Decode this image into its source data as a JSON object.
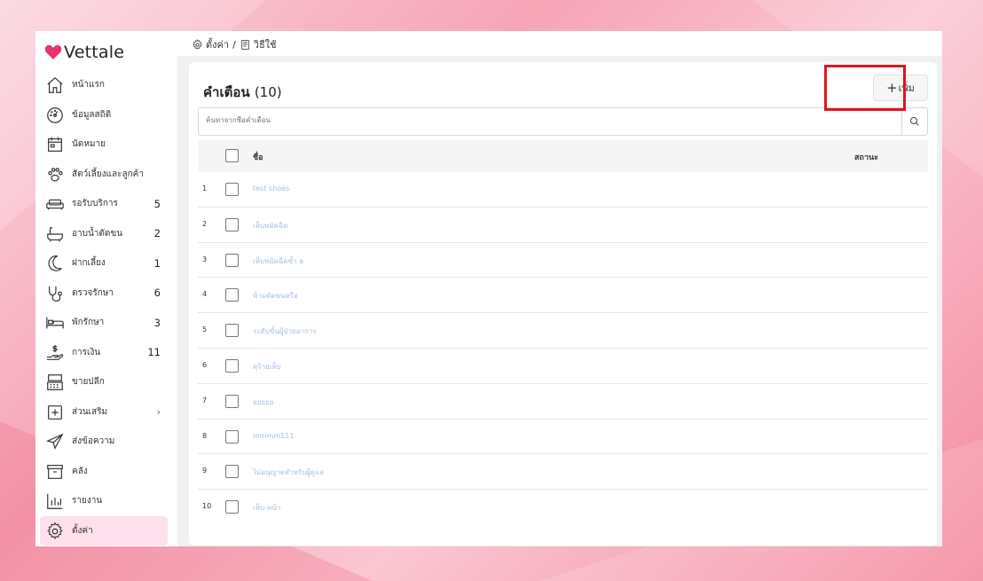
{
  "brand": {
    "name": "Vettale",
    "color": "#e8336d"
  },
  "sidebar": {
    "items": [
      {
        "label": "หน้าแรก",
        "icon": "home-icon",
        "count": ""
      },
      {
        "label": "ข้อมูลสถิติ",
        "icon": "stats-dial-icon",
        "count": ""
      },
      {
        "label": "นัดหมาย",
        "icon": "calendar-icon",
        "count": ""
      },
      {
        "label": "สัตว์เลี้ยงและลูกค้า",
        "icon": "paw-icon",
        "count": ""
      },
      {
        "label": "รอรับบริการ",
        "icon": "sofa-icon",
        "count": "5"
      },
      {
        "label": "อาบน้ำตัดขน",
        "icon": "bathtub-icon",
        "count": "2"
      },
      {
        "label": "ฝากเลี้ยง",
        "icon": "moon-icon",
        "count": "1"
      },
      {
        "label": "ตรวจรักษา",
        "icon": "stethoscope-icon",
        "count": "6"
      },
      {
        "label": "พักรักษา",
        "icon": "bed-icon",
        "count": "3"
      },
      {
        "label": "การเงิน",
        "icon": "money-hand-icon",
        "count": "11"
      },
      {
        "label": "ขายปลีก",
        "icon": "cash-register-icon",
        "count": ""
      },
      {
        "label": "ส่วนเสริม",
        "icon": "plus-square-icon",
        "count": "",
        "chevron": "›"
      },
      {
        "label": "ส่งข้อความ",
        "icon": "paper-plane-icon",
        "count": ""
      },
      {
        "label": "คลัง",
        "icon": "archive-box-icon",
        "count": ""
      },
      {
        "label": "รายงาน",
        "icon": "bar-chart-icon",
        "count": ""
      },
      {
        "label": "ตั้งค่า",
        "icon": "gear-icon",
        "count": "",
        "active": true
      }
    ]
  },
  "breadcrumb": {
    "root": "ตั้งค่า",
    "separator": "/",
    "current": "วิธีใช้"
  },
  "page": {
    "title": "คำเตือน",
    "count": "(10)",
    "add_button": {
      "symbol": "+",
      "label": "เพิ่ม"
    },
    "search": {
      "placeholder": "ค้นหาจากชื่อคำเตือน"
    }
  },
  "table": {
    "headers": {
      "name": "ชื่อ",
      "status": "สถานะ"
    },
    "rows": [
      {
        "num": "1",
        "name": "test shoes"
      },
      {
        "num": "2",
        "name": "เห็บหมัดฉีด"
      },
      {
        "num": "3",
        "name": "เห็บหมัดฉีดซ้ำ a"
      },
      {
        "num": "4",
        "name": "ห้ามตัดขนหรือ"
      },
      {
        "num": "5",
        "name": "ระดับขั้นผู้ป่วยอาการ"
      },
      {
        "num": "6",
        "name": "ดุร้ายเห็บ"
      },
      {
        "num": "7",
        "name": "ยยยยย"
      },
      {
        "num": "8",
        "name": "mmmm111"
      },
      {
        "num": "9",
        "name": "ไม่อนุญาตสำหรับผู้ดูแล"
      },
      {
        "num": "10",
        "name": "เห็บ-หน้า"
      }
    ]
  }
}
